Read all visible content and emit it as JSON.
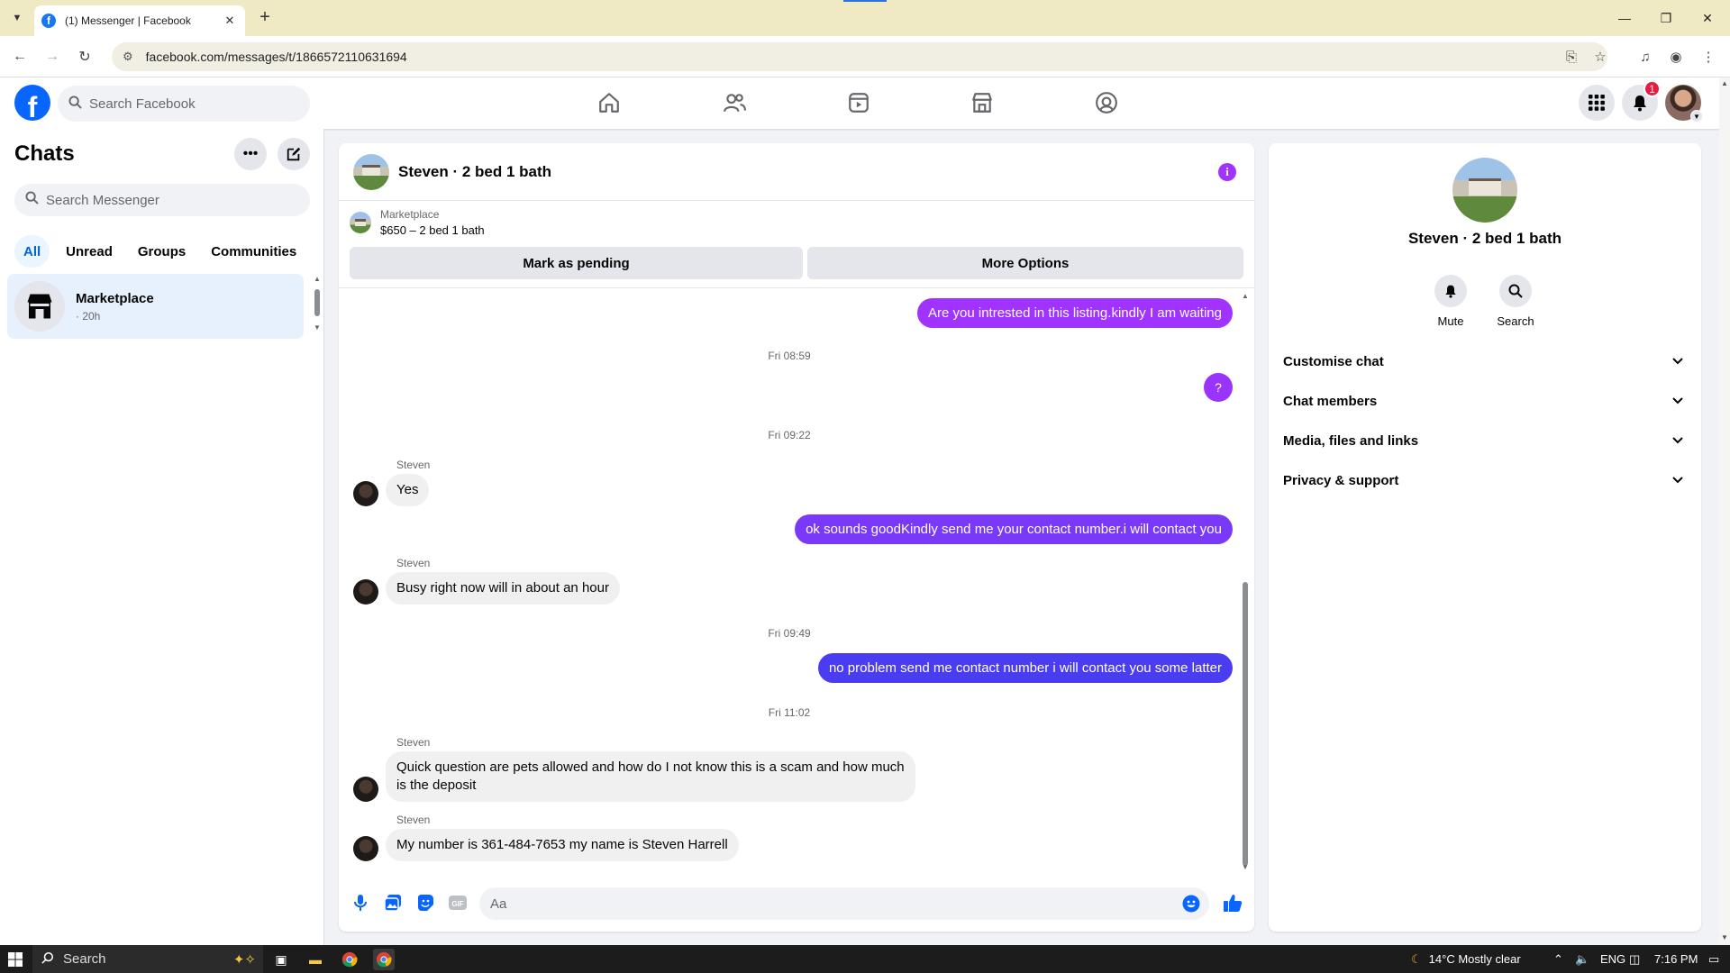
{
  "browser": {
    "tab_title": "(1) Messenger | Facebook",
    "url": "facebook.com/messages/t/1866572110631694"
  },
  "fbnav": {
    "search_placeholder": "Search Facebook",
    "notification_count": "1"
  },
  "sidebar": {
    "title": "Chats",
    "search_placeholder": "Search Messenger",
    "filters": [
      "All",
      "Unread",
      "Groups",
      "Communities"
    ],
    "chats": [
      {
        "name": "Marketplace",
        "time": "· 20h"
      }
    ]
  },
  "conversation": {
    "title": "Steven · 2 bed 1 bath",
    "listing": {
      "source": "Marketplace",
      "price_title": "$650 – 2 bed 1 bath"
    },
    "buttons": {
      "mark_pending": "Mark as pending",
      "more_options": "More Options"
    },
    "messages": [
      {
        "type": "outgoing",
        "text": "Are you intrested in this listing.kindly I am waiting"
      },
      {
        "type": "timestamp",
        "text": "Fri 08:59"
      },
      {
        "type": "outgoing",
        "text": "?"
      },
      {
        "type": "timestamp",
        "text": "Fri 09:22"
      },
      {
        "type": "incoming",
        "sender": "Steven",
        "text": "Yes"
      },
      {
        "type": "outgoing",
        "text": "ok sounds goodKindly send me your contact number.i will contact you"
      },
      {
        "type": "incoming",
        "sender": "Steven",
        "text": "Busy right now will in about an hour"
      },
      {
        "type": "timestamp",
        "text": "Fri 09:49"
      },
      {
        "type": "outgoing",
        "text": "no problem send me contact number i will contact you some latter"
      },
      {
        "type": "timestamp",
        "text": "Fri 11:02"
      },
      {
        "type": "incoming",
        "sender": "Steven",
        "text": "Quick question are pets allowed and how do I not know this is a scam and how much is the deposit"
      },
      {
        "type": "incoming",
        "sender": "Steven",
        "text": "My number is 361-484-7653 my name is Steven Harrell"
      }
    ],
    "composer_placeholder": "Aa",
    "colors": {
      "outgoing_top": "#a033ff",
      "outgoing_bottom": "#4a3cf0",
      "accent": "#0866ff"
    }
  },
  "info_panel": {
    "name": "Steven · 2 bed 1 bath",
    "actions": [
      "Mute",
      "Search"
    ],
    "sections": [
      "Customise chat",
      "Chat members",
      "Media, files and links",
      "Privacy & support"
    ]
  },
  "taskbar": {
    "search_label": "Search",
    "weather": "14°C  Mostly clear",
    "language": "ENG",
    "time": "7:16 PM"
  }
}
